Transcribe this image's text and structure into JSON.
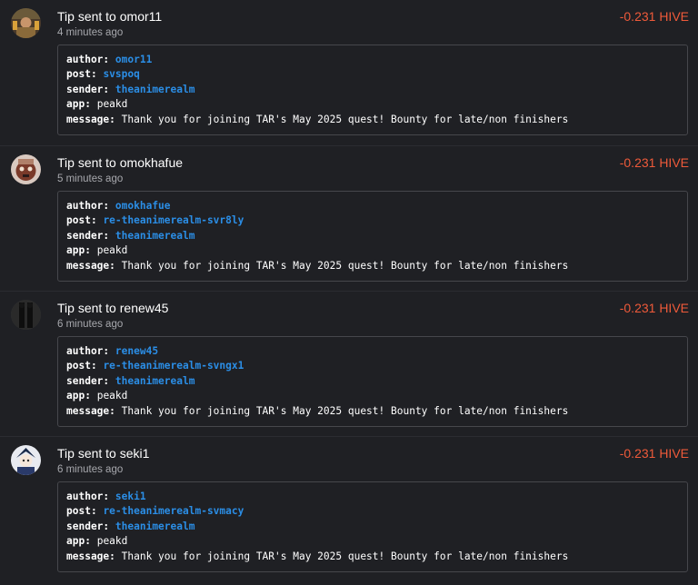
{
  "colors": {
    "background": "#1f2024",
    "amount": "#ef5a3a",
    "link": "#2b8ee6",
    "card_border": "#46474c",
    "muted_text": "#a7a8ad"
  },
  "labels": {
    "author": "author:",
    "post": "post:",
    "sender": "sender:",
    "app": "app:",
    "message": "message:"
  },
  "entries": [
    {
      "title_prefix": "Tip sent to ",
      "recipient": "omor11",
      "time": "4 minutes ago",
      "amount": "-0.231 HIVE",
      "author": "omor11",
      "post": "svspoq",
      "sender": "theanimerealm",
      "app": "peakd",
      "message": "Thank you for joining TAR's May 2025 quest! Bounty for late/non finishers"
    },
    {
      "title_prefix": "Tip sent to ",
      "recipient": "omokhafue",
      "time": "5 minutes ago",
      "amount": "-0.231 HIVE",
      "author": "omokhafue",
      "post": "re-theanimerealm-svr8ly",
      "sender": "theanimerealm",
      "app": "peakd",
      "message": "Thank you for joining TAR's May 2025 quest! Bounty for late/non finishers"
    },
    {
      "title_prefix": "Tip sent to ",
      "recipient": "renew45",
      "time": "6 minutes ago",
      "amount": "-0.231 HIVE",
      "author": "renew45",
      "post": "re-theanimerealm-svngx1",
      "sender": "theanimerealm",
      "app": "peakd",
      "message": "Thank you for joining TAR's May 2025 quest! Bounty for late/non finishers"
    },
    {
      "title_prefix": "Tip sent to ",
      "recipient": "seki1",
      "time": "6 minutes ago",
      "amount": "-0.231 HIVE",
      "author": "seki1",
      "post": "re-theanimerealm-svmacy",
      "sender": "theanimerealm",
      "app": "peakd",
      "message": "Thank you for joining TAR's May 2025 quest! Bounty for late/non finishers"
    }
  ]
}
